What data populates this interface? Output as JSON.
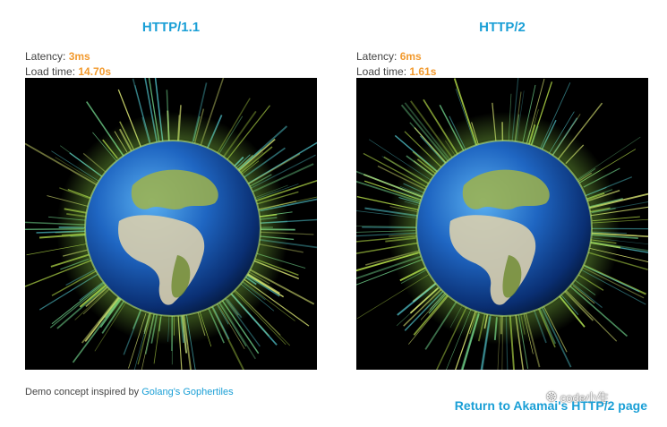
{
  "left_panel": {
    "title": "HTTP/1.1",
    "latency_label": "Latency: ",
    "latency_value": "3ms",
    "load_label": "Load time: ",
    "load_value": "14.70s"
  },
  "right_panel": {
    "title": "HTTP/2",
    "latency_label": "Latency: ",
    "latency_value": "6ms",
    "load_label": "Load time: ",
    "load_value": "1.61s"
  },
  "footer": {
    "credit_prefix": "Demo concept inspired by ",
    "credit_link": "Golang's Gophertiles",
    "return_link": "Return to Akamai's HTTP/2 page"
  },
  "watermark": {
    "icon": "wechat-icon",
    "text": "code小生"
  },
  "colors": {
    "accent": "#1a9fd6",
    "value": "#f29a2e",
    "text": "#444444"
  }
}
